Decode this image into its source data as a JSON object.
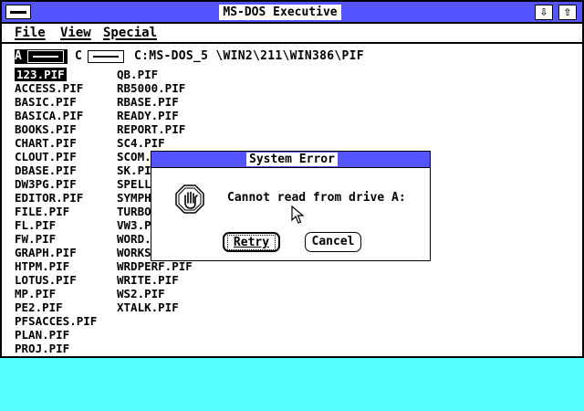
{
  "window": {
    "title": "MS-DOS Executive",
    "minimize_glyph": "⇩",
    "maximize_glyph": "⇧"
  },
  "menu": {
    "items": [
      "File",
      "View",
      "Special"
    ]
  },
  "drives": [
    {
      "letter": "A",
      "selected": true
    },
    {
      "letter": "C",
      "selected": false
    }
  ],
  "current_path": "C:MS-DOS_5 \\WIN2\\211\\WIN386\\PIF",
  "files": {
    "column1": [
      "123.PIF",
      "ACCESS.PIF",
      "BASIC.PIF",
      "BASICA.PIF",
      "BOOKS.PIF",
      "CHART.PIF",
      "CLOUT.PIF",
      "DBASE.PIF",
      "DW3PG.PIF",
      "EDITOR.PIF",
      "FILE.PIF",
      "FL.PIF",
      "FW.PIF",
      "GRAPH.PIF",
      "HTPM.PIF",
      "LOTUS.PIF",
      "MP.PIF",
      "PE2.PIF",
      "PFSACCES.PIF",
      "PLAN.PIF",
      "PROJ.PIF"
    ],
    "column2": [
      "QB.PIF",
      "RB5000.PIF",
      "RBASE.PIF",
      "READY.PIF",
      "REPORT.PIF",
      "SC4.PIF",
      "SCOM.",
      "SK.PI",
      "SPELL",
      "SYMPH",
      "TURBO",
      "VW3.P",
      "WORD.",
      "WORKS",
      "WRDPERF.PIF",
      "WRITE.PIF",
      "WS2.PIF",
      "XTALK.PIF"
    ],
    "selected": "123.PIF"
  },
  "dialog": {
    "title": "System Error",
    "message": "Cannot read from drive A:",
    "icon": "stop-hand-icon",
    "buttons": {
      "retry": "Retry",
      "cancel": "Cancel"
    }
  },
  "colors": {
    "desktop": "#55ffff",
    "titlebar": "#5555ff"
  }
}
